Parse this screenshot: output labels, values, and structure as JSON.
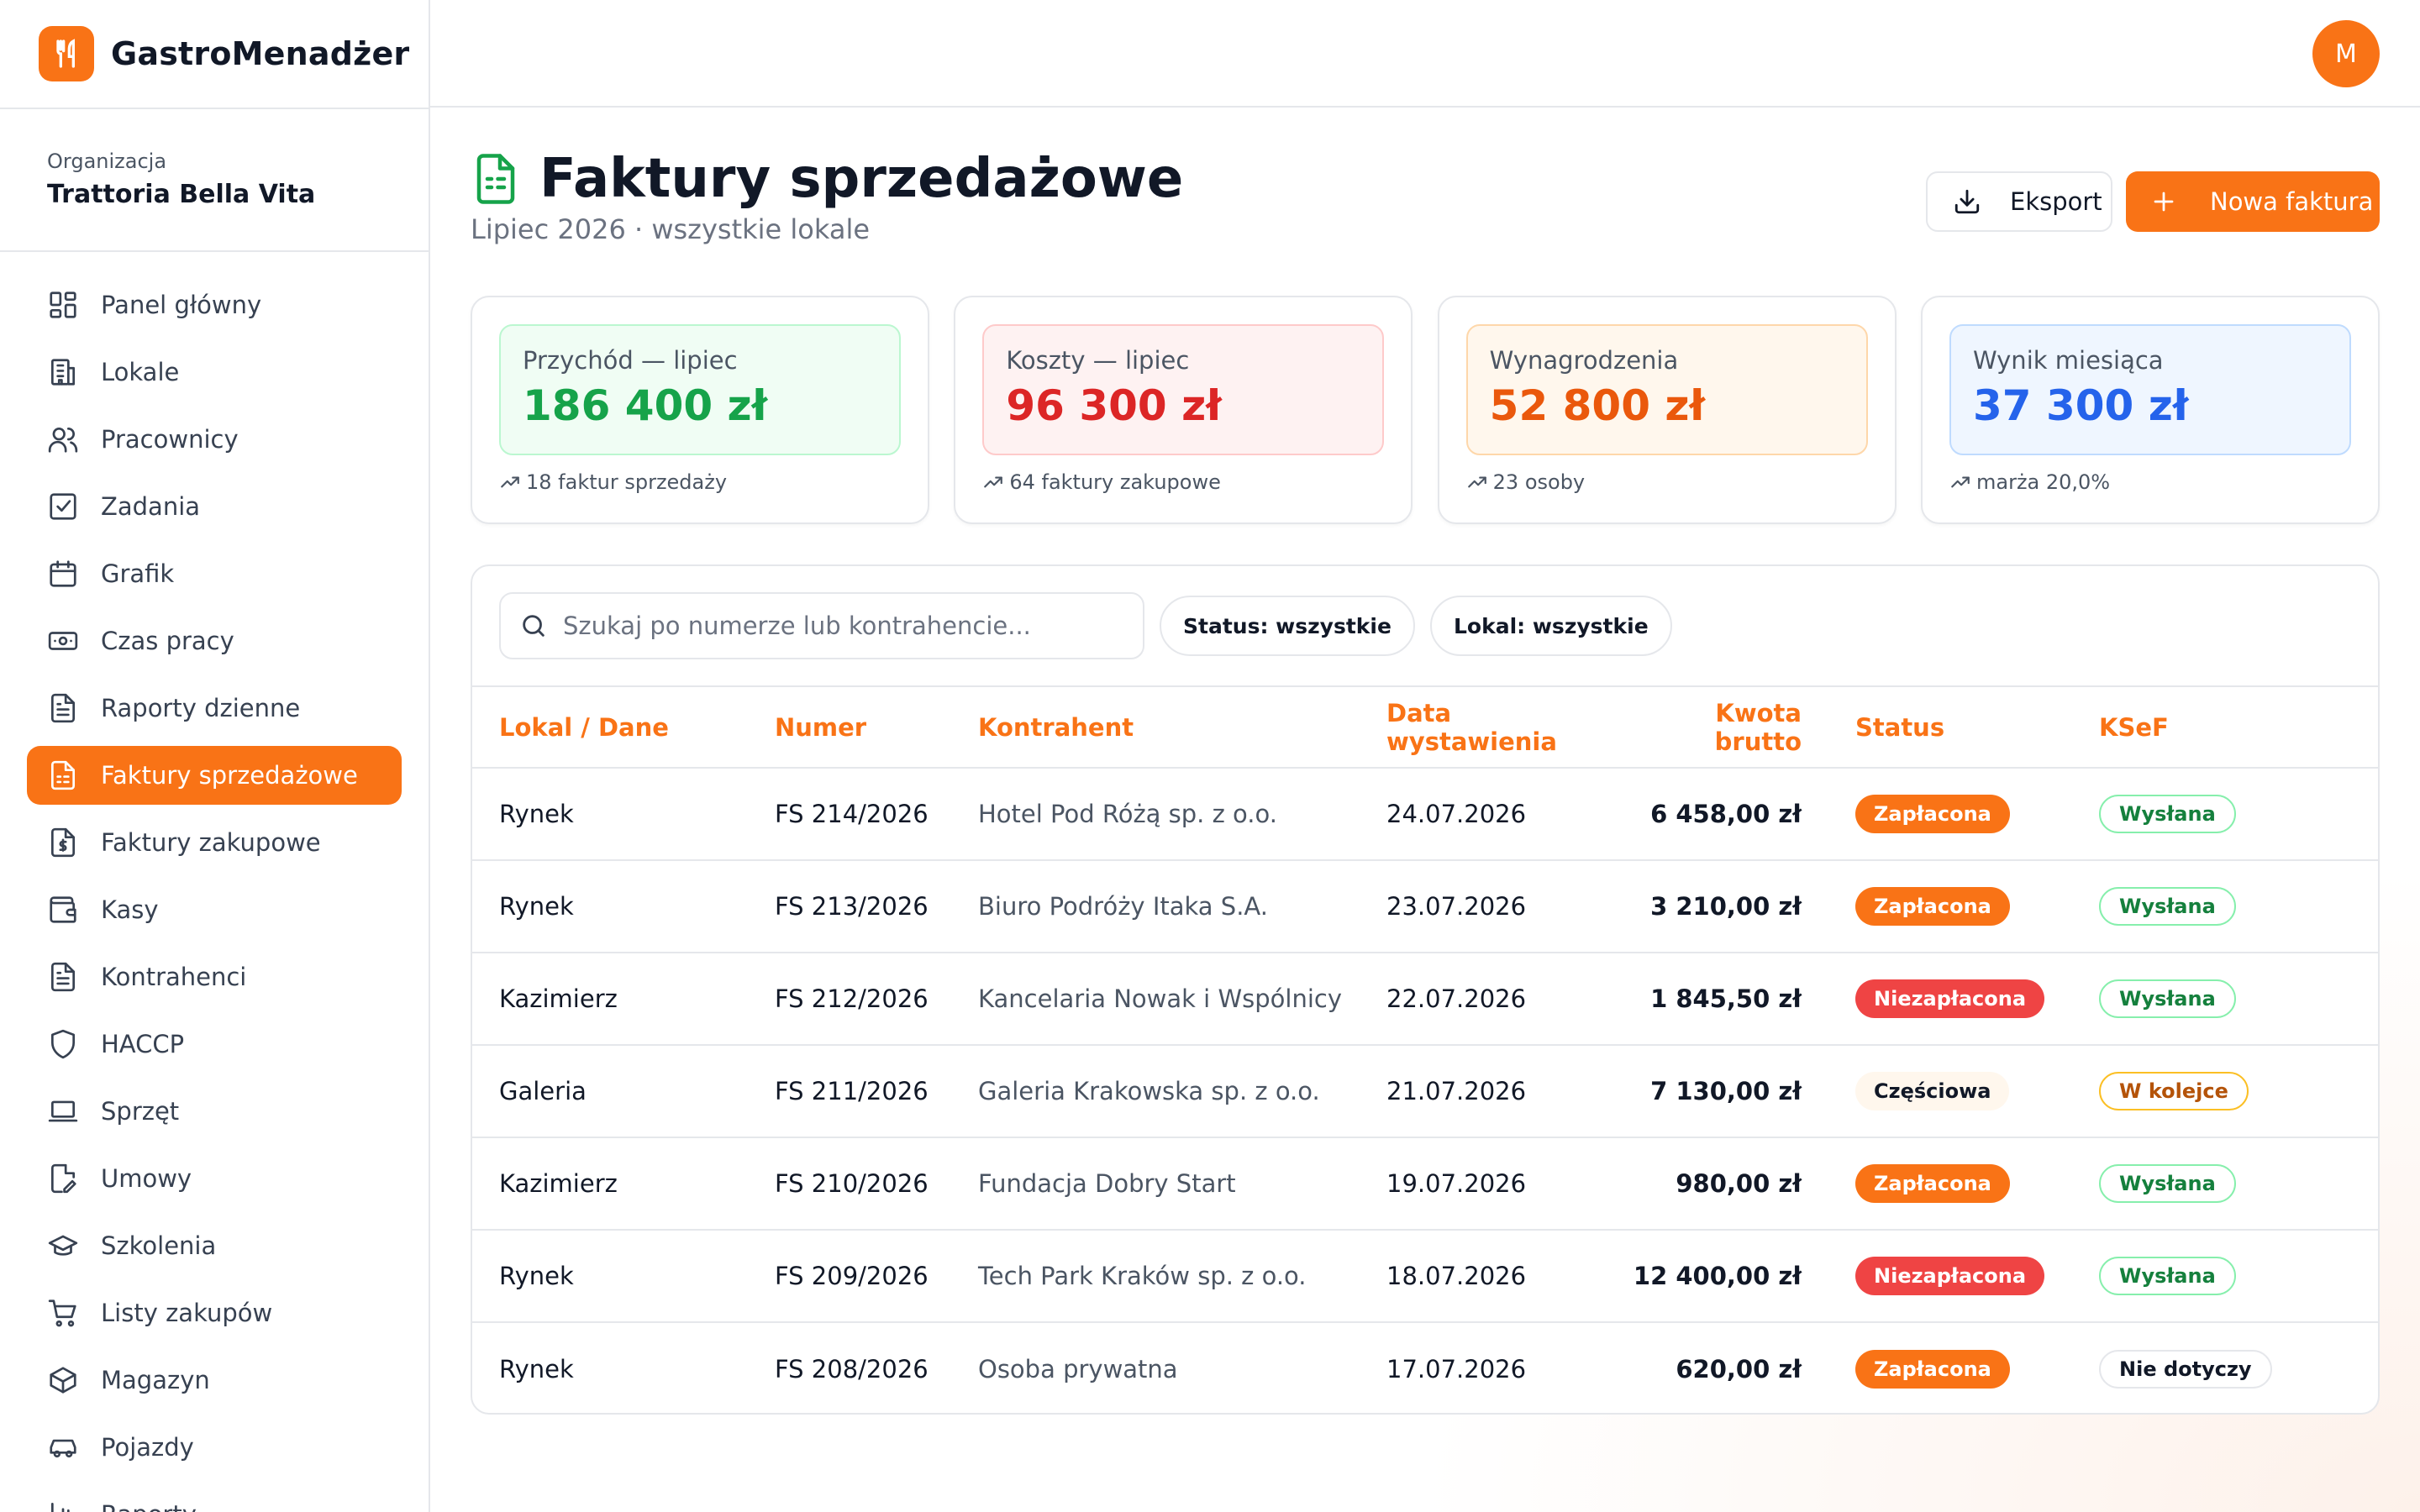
{
  "app": {
    "name": "GastroMenadżer",
    "user_initial": "M"
  },
  "org": {
    "label": "Organizacja",
    "name": "Trattoria Bella Vita"
  },
  "nav": [
    {
      "id": "panel",
      "label": "Panel główny",
      "icon": "dashboard-icon"
    },
    {
      "id": "lokale",
      "label": "Lokale",
      "icon": "building-icon"
    },
    {
      "id": "pracownicy",
      "label": "Pracownicy",
      "icon": "users-icon"
    },
    {
      "id": "zadania",
      "label": "Zadania",
      "icon": "checkbox-icon"
    },
    {
      "id": "grafik",
      "label": "Grafik",
      "icon": "calendar-icon"
    },
    {
      "id": "czas",
      "label": "Czas pracy",
      "icon": "banknote-icon"
    },
    {
      "id": "raporty",
      "label": "Raporty dzienne",
      "icon": "document-icon"
    },
    {
      "id": "faktury-sprzedazowe",
      "label": "Faktury sprzedażowe",
      "icon": "invoice-icon",
      "active": true
    },
    {
      "id": "faktury-zakupowe",
      "label": "Faktury zakupowe",
      "icon": "dollar-document-icon"
    },
    {
      "id": "kasy",
      "label": "Kasy",
      "icon": "wallet-icon"
    },
    {
      "id": "kontrahenci",
      "label": "Kontrahenci",
      "icon": "document-icon"
    },
    {
      "id": "haccp",
      "label": "HACCP",
      "icon": "shield-icon"
    },
    {
      "id": "sprzet",
      "label": "Sprzęt",
      "icon": "laptop-icon"
    },
    {
      "id": "umowy",
      "label": "Umowy",
      "icon": "contract-icon"
    },
    {
      "id": "szkolenia",
      "label": "Szkolenia",
      "icon": "graduation-cap-icon"
    },
    {
      "id": "listy",
      "label": "Listy zakupów",
      "icon": "cart-icon"
    },
    {
      "id": "magazyn",
      "label": "Magazyn",
      "icon": "box-icon"
    },
    {
      "id": "pojazdy",
      "label": "Pojazdy",
      "icon": "car-icon"
    },
    {
      "id": "raporty2",
      "label": "Raporty",
      "icon": "chart-icon"
    }
  ],
  "page": {
    "title": "Faktury sprzedażowe",
    "subtitle": "Lipiec 2026 · wszystkie lokale",
    "export_label": "Eksport",
    "new_label": "Nowa faktura"
  },
  "kpis": [
    {
      "label": "Przychód — lipiec",
      "value": "186 400 zł",
      "foot": "18 faktur sprzedaży",
      "color": "#16a34a",
      "bg": "#f0fdf4",
      "border": "#bbf7d0"
    },
    {
      "label": "Koszty — lipiec",
      "value": "96 300 zł",
      "foot": "64 faktury zakupowe",
      "color": "#dc2626",
      "bg": "#fef2f2",
      "border": "#fecaca"
    },
    {
      "label": "Wynagrodzenia",
      "value": "52 800 zł",
      "foot": "23 osoby",
      "color": "#ea580c",
      "bg": "#fff7ed",
      "border": "#fed7aa"
    },
    {
      "label": "Wynik miesiąca",
      "value": "37 300 zł",
      "foot": "marża 20,0%",
      "color": "#2563eb",
      "bg": "#eff6ff",
      "border": "#bfdbfe"
    }
  ],
  "filters": {
    "search_placeholder": "Szukaj po numerze lub kontrahencie...",
    "status_chip": "Status: wszystkie",
    "lokal_chip": "Lokal: wszystkie"
  },
  "table": {
    "headers": [
      "Lokal / Dane",
      "Numer",
      "Kontrahent",
      "Data wystawienia",
      "Kwota brutto",
      "Status",
      "KSeF"
    ],
    "rows": [
      {
        "lokal": "Rynek",
        "numer": "FS 214/2026",
        "kontrahent": "Hotel Pod Różą sp. z o.o.",
        "data": "24.07.2026",
        "kwota": "6 458,00 zł",
        "status": "Zapłacona",
        "status_kind": "paid",
        "ksef": "Wysłana",
        "ksef_kind": "sent"
      },
      {
        "lokal": "Rynek",
        "numer": "FS 213/2026",
        "kontrahent": "Biuro Podróży Itaka S.A.",
        "data": "23.07.2026",
        "kwota": "3 210,00 zł",
        "status": "Zapłacona",
        "status_kind": "paid",
        "ksef": "Wysłana",
        "ksef_kind": "sent"
      },
      {
        "lokal": "Kazimierz",
        "numer": "FS 212/2026",
        "kontrahent": "Kancelaria Nowak i Wspólnicy",
        "data": "22.07.2026",
        "kwota": "1 845,50 zł",
        "status": "Niezapłacona",
        "status_kind": "unpaid",
        "ksef": "Wysłana",
        "ksef_kind": "sent"
      },
      {
        "lokal": "Galeria",
        "numer": "FS 211/2026",
        "kontrahent": "Galeria Krakowska sp. z o.o.",
        "data": "21.07.2026",
        "kwota": "7 130,00 zł",
        "status": "Częściowa",
        "status_kind": "partial",
        "ksef": "W kolejce",
        "ksef_kind": "queued"
      },
      {
        "lokal": "Kazimierz",
        "numer": "FS 210/2026",
        "kontrahent": "Fundacja Dobry Start",
        "data": "19.07.2026",
        "kwota": "980,00 zł",
        "status": "Zapłacona",
        "status_kind": "paid",
        "ksef": "Wysłana",
        "ksef_kind": "sent"
      },
      {
        "lokal": "Rynek",
        "numer": "FS 209/2026",
        "kontrahent": "Tech Park Kraków sp. z o.o.",
        "data": "18.07.2026",
        "kwota": "12 400,00 zł",
        "status": "Niezapłacona",
        "status_kind": "unpaid",
        "ksef": "Wysłana",
        "ksef_kind": "sent"
      },
      {
        "lokal": "Rynek",
        "numer": "FS 208/2026",
        "kontrahent": "Osoba prywatna",
        "data": "17.07.2026",
        "kwota": "620,00 zł",
        "status": "Zapłacona",
        "status_kind": "paid",
        "ksef": "Nie dotyczy",
        "ksef_kind": "na"
      }
    ]
  },
  "colors": {
    "accent": "#f97316",
    "paid": "#f97316",
    "unpaid": "#ef4444",
    "sent": "#16a34a",
    "queued": "#d97706"
  }
}
